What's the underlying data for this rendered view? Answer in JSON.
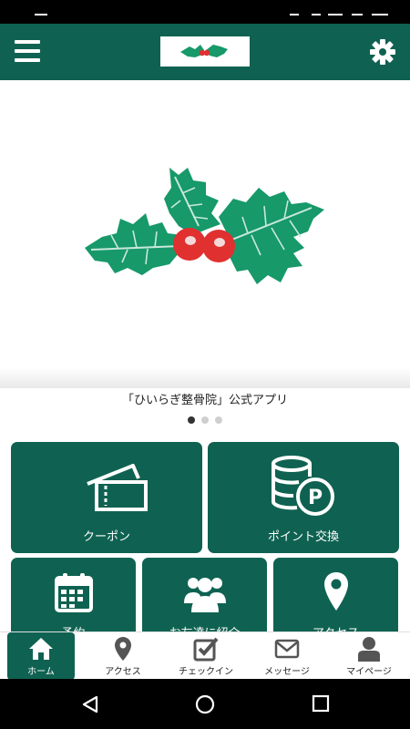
{
  "app": {
    "caption": "「ひいらぎ整骨院」公式アプリ",
    "carousel": {
      "count": 3,
      "active": 1
    }
  },
  "colors": {
    "brand": "#0f6251",
    "berry": "#e03030",
    "leaf": "#17996a"
  },
  "tiles": [
    {
      "label": "クーポン",
      "icon": "ticket-icon"
    },
    {
      "label": "ポイント交換",
      "icon": "coins-point-icon"
    },
    {
      "label": "予約",
      "icon": "calendar-icon"
    },
    {
      "label": "お友達に紹介",
      "icon": "users-icon"
    },
    {
      "label": "アクセス",
      "icon": "map-pin-icon"
    }
  ],
  "bottom_nav": [
    {
      "label": "ホーム",
      "icon": "home-icon",
      "active": true
    },
    {
      "label": "アクセス",
      "icon": "map-pin-icon",
      "active": false
    },
    {
      "label": "チェックイン",
      "icon": "checkbox-icon",
      "active": false
    },
    {
      "label": "メッセージ",
      "icon": "mail-icon",
      "active": false
    },
    {
      "label": "マイページ",
      "icon": "user-icon",
      "active": false
    }
  ],
  "system_nav": [
    "back-icon",
    "home-circle-icon",
    "recents-icon"
  ]
}
